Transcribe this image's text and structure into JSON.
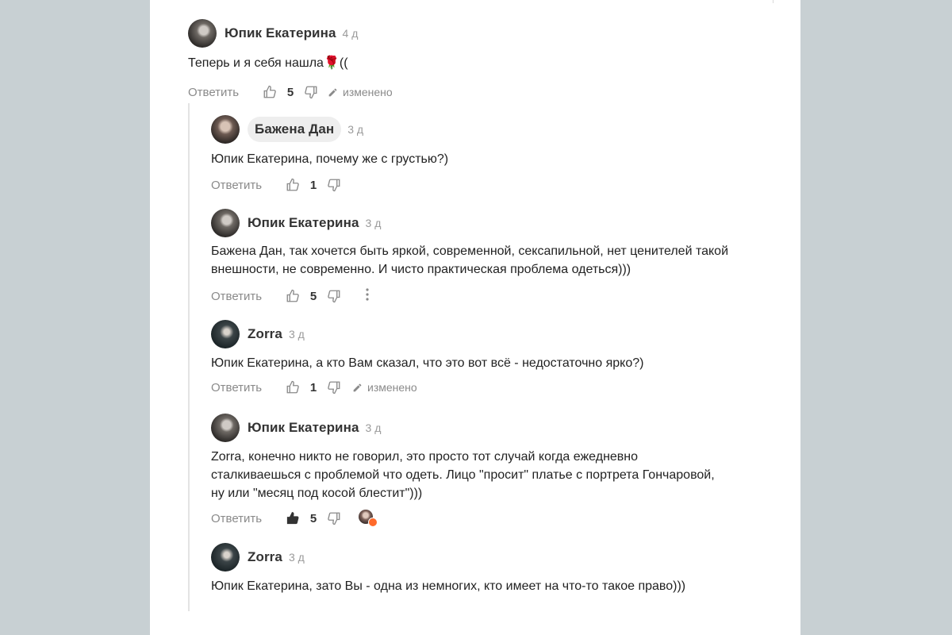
{
  "colors": {
    "background": "#c8d0d3",
    "card": "#ffffff",
    "muted": "#8a8a8a",
    "reaction_heart": "#ff6a2b"
  },
  "comments": [
    {
      "author": "Юпик Екатерина",
      "time": "4 д",
      "text": "Теперь и я себя нашла",
      "emoji": "🌹",
      "text_tail": "((",
      "reply_label": "Ответить",
      "likes": "5",
      "edited_label": "изменено"
    },
    {
      "author": "Бажена Дан",
      "time": "3 д",
      "text": "Юпик Екатерина, почему же с грустью?)",
      "reply_label": "Ответить",
      "likes": "1"
    },
    {
      "author": "Юпик Екатерина",
      "time": "3 д",
      "text": "Бажена Дан, так хочется быть яркой, современной, сексапильной, нет ценителей такой внешности, не современно. И чисто практическая проблема одеться)))",
      "reply_label": "Ответить",
      "likes": "5"
    },
    {
      "author": "Zorra",
      "time": "3 д",
      "text": "Юпик Екатерина, а кто Вам сказал, что это вот всё - недостаточно ярко?)",
      "reply_label": "Ответить",
      "likes": "1",
      "edited_label": "изменено"
    },
    {
      "author": "Юпик Екатерина",
      "time": "3 д",
      "text": "Zorra, конечно никто не говорил, это просто тот случай когда ежедневно сталкиваешься с проблемой что одеть. Лицо \"просит\" платье с портрета Гончаровой, ну или \"месяц под косой блестит\")))",
      "reply_label": "Ответить",
      "likes": "5"
    },
    {
      "author": "Zorra",
      "time": "3 д",
      "text": "Юпик Екатерина, зато Вы - одна из немногих, кто имеет на что-то такое право)))"
    }
  ]
}
